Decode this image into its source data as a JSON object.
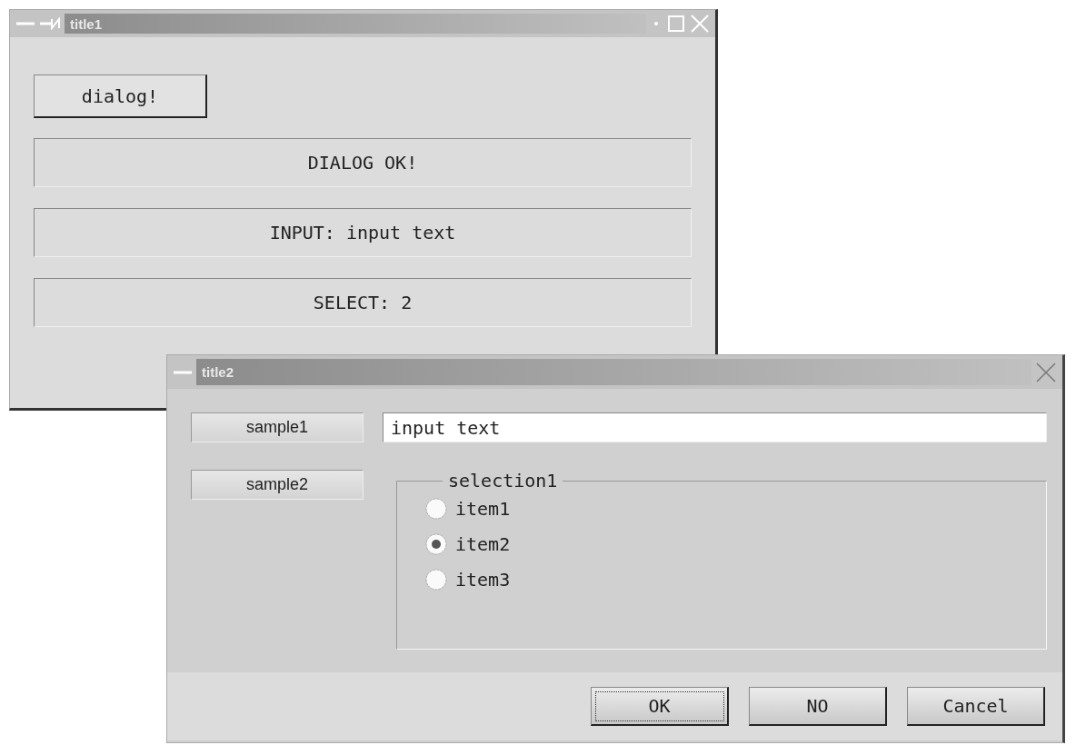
{
  "main_window": {
    "title": "title1",
    "dialog_button": "dialog!",
    "outputs": [
      "DIALOG OK!",
      "INPUT: input text",
      "SELECT: 2"
    ]
  },
  "dialog": {
    "title": "title2",
    "side_buttons": [
      "sample1",
      "sample2"
    ],
    "input": {
      "value": "input text"
    },
    "group": {
      "label": "selection1",
      "options": [
        {
          "label": "item1",
          "selected": false
        },
        {
          "label": "item2",
          "selected": true
        },
        {
          "label": "item3",
          "selected": false
        }
      ]
    },
    "buttons": [
      {
        "label": "OK",
        "focused": true
      },
      {
        "label": "NO",
        "focused": false
      },
      {
        "label": "Cancel",
        "focused": false
      }
    ]
  }
}
